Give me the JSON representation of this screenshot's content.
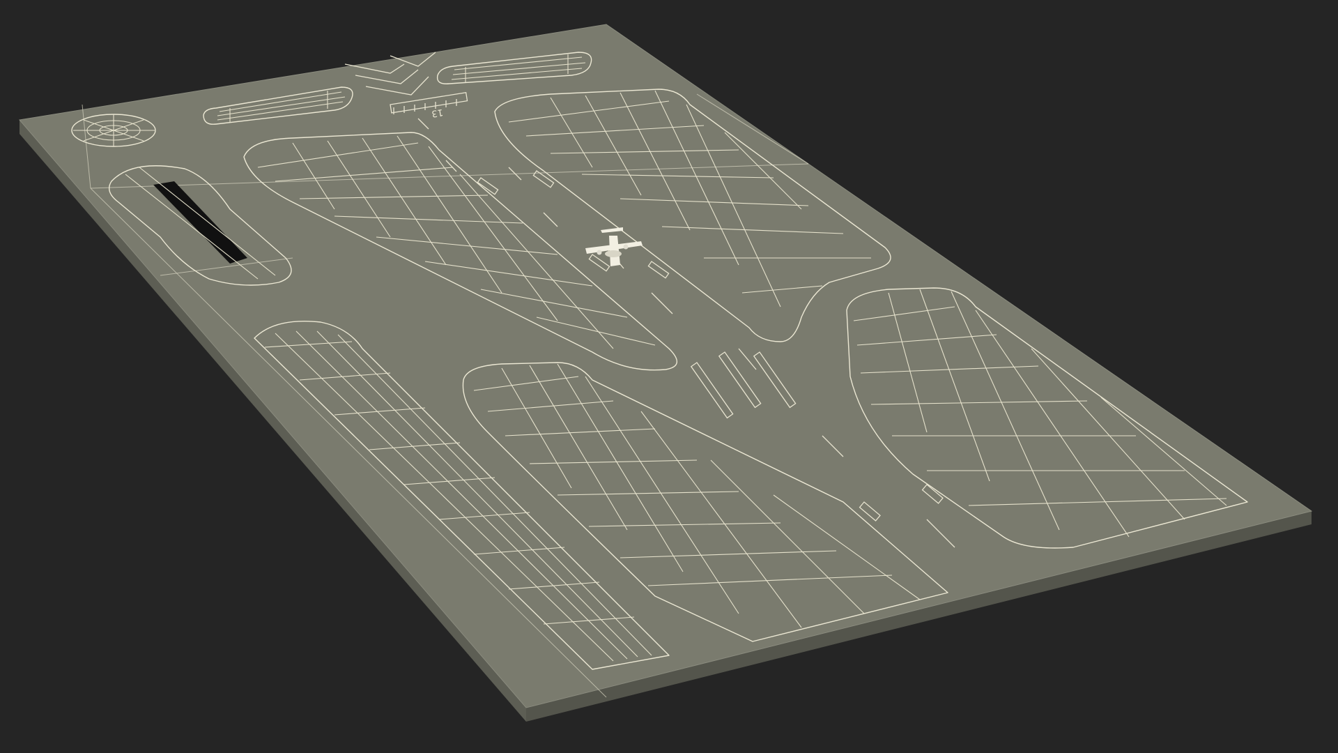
{
  "scene": {
    "background_color": "#252525",
    "plate_top_color": "#7a7b6e",
    "plate_side_color": "#5d5e54",
    "plate_edge_color": "#8a8b7e",
    "wire_color": "#ece8d4",
    "slot_color": "#111111",
    "aircraft_color": "#f2efe2"
  },
  "runway": {
    "number_text": "13"
  },
  "icons": {
    "aircraft": "airplane-icon"
  }
}
